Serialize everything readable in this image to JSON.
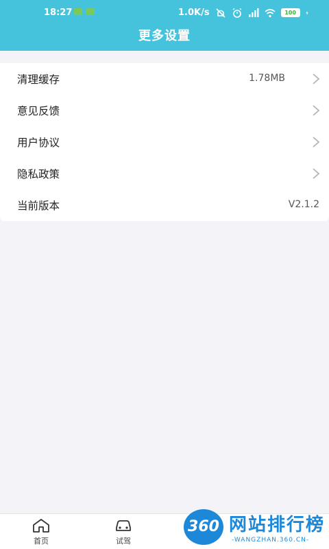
{
  "status_bar": {
    "time": "18:27",
    "network_speed": "1.0K/s",
    "battery_level": "100"
  },
  "header": {
    "title": "更多设置"
  },
  "settings": {
    "items": [
      {
        "label": "清理缓存",
        "value": "1.78MB",
        "has_chevron": true
      },
      {
        "label": "意见反馈",
        "value": "",
        "has_chevron": true
      },
      {
        "label": "用户协议",
        "value": "",
        "has_chevron": true
      },
      {
        "label": "隐私政策",
        "value": "",
        "has_chevron": true
      },
      {
        "label": "当前版本",
        "value": "V2.1.2",
        "has_chevron": false
      }
    ]
  },
  "tabbar": {
    "tabs": [
      {
        "label": "首页",
        "icon": "home-icon"
      },
      {
        "label": "试驾",
        "icon": "car-icon"
      }
    ]
  },
  "watermark": {
    "badge": "360",
    "text": "网站排行榜",
    "sub": "-WANGZHAN.360.CN-"
  },
  "colors": {
    "header_bg": "#46c3dc",
    "page_bg": "#f4f4f8",
    "watermark_blue": "#1e88d8"
  }
}
